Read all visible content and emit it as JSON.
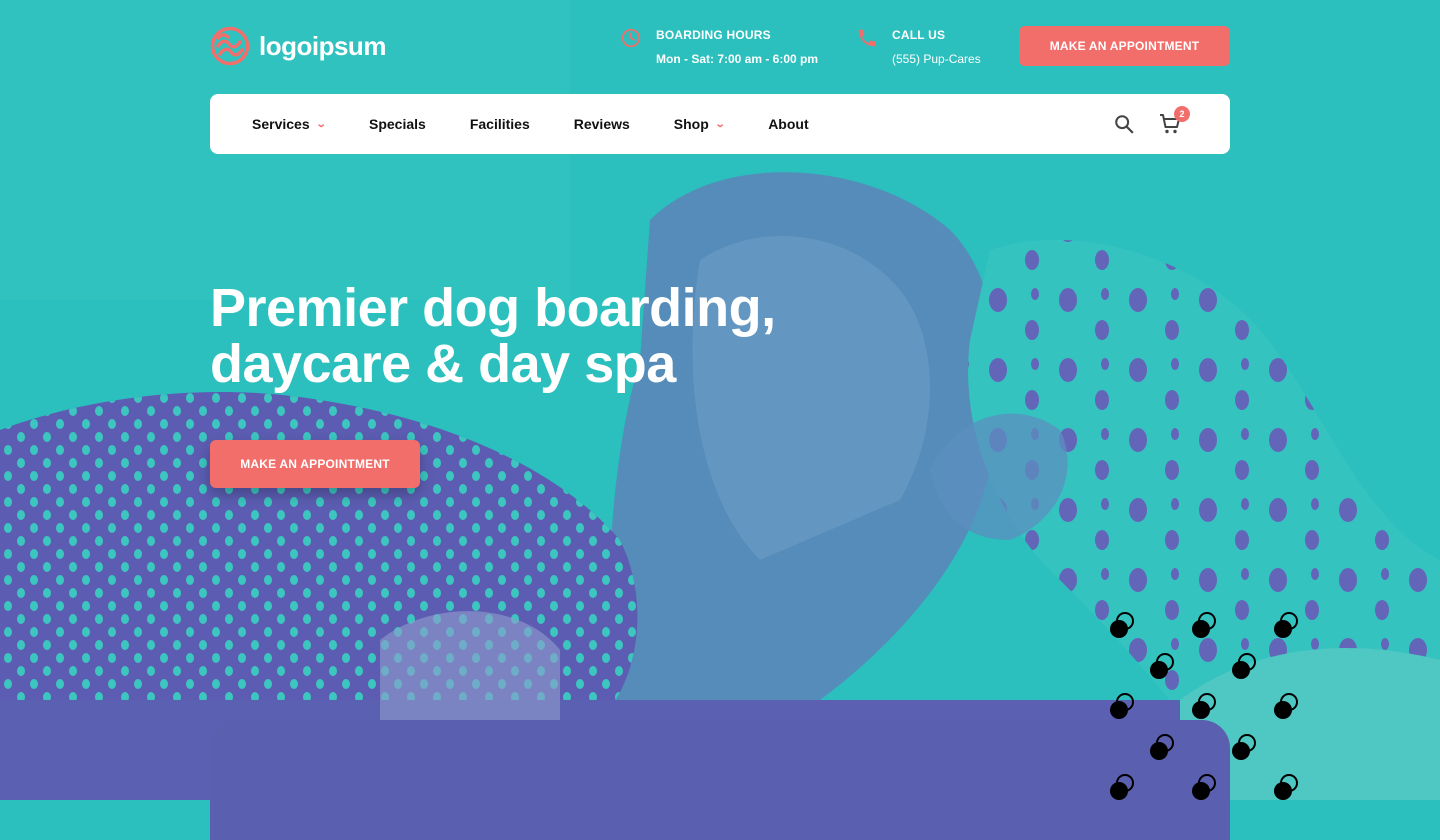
{
  "brand": {
    "name": "logoipsum",
    "logo_icon": "logo-mark-icon",
    "accent": "#f26e6b",
    "teal": "#2bbfbd",
    "purple": "#5b5fb0"
  },
  "header": {
    "hours": {
      "icon": "clock-icon",
      "title": "BOARDING HOURS",
      "value": "Mon - Sat: 7:00 am - 6:00 pm"
    },
    "call": {
      "icon": "phone-icon",
      "title": "CALL US",
      "value": "(555) Pup-Cares"
    },
    "cta_label": "MAKE AN APPOINTMENT"
  },
  "nav": {
    "items": [
      {
        "label": "Services",
        "has_dropdown": true
      },
      {
        "label": "Specials",
        "has_dropdown": false
      },
      {
        "label": "Facilities",
        "has_dropdown": false
      },
      {
        "label": "Reviews",
        "has_dropdown": false
      },
      {
        "label": "Shop",
        "has_dropdown": true
      },
      {
        "label": "About",
        "has_dropdown": false
      }
    ],
    "search_icon": "search-icon",
    "cart_icon": "cart-icon",
    "cart_count": "2"
  },
  "hero": {
    "title_line1": "Premier dog boarding,",
    "title_line2": "daycare & day spa",
    "cta_label": "MAKE AN APPOINTMENT"
  }
}
